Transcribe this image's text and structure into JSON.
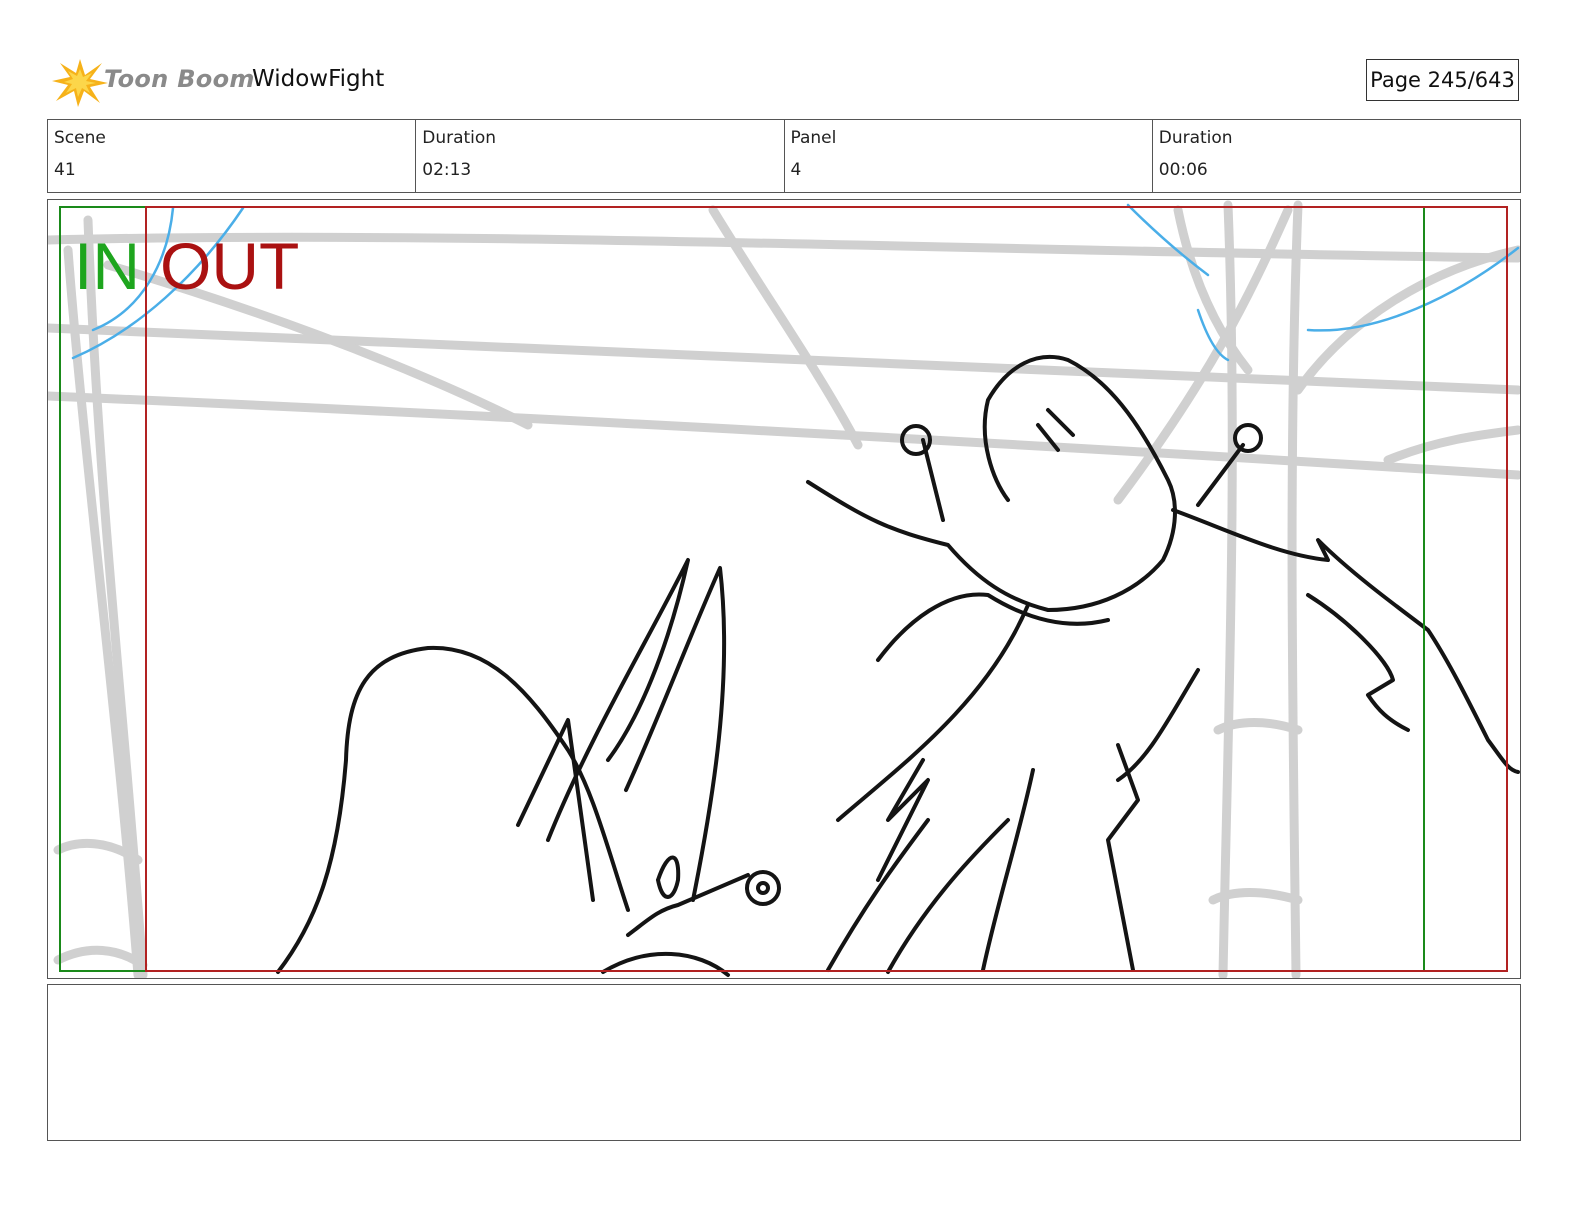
{
  "header": {
    "logo_text": "Toon Boom",
    "project_title": "WidowFight",
    "page_label": "Page 245/643"
  },
  "info": [
    {
      "label": "Scene",
      "value": "41"
    },
    {
      "label": "Duration",
      "value": "02:13"
    },
    {
      "label": "Panel",
      "value": "4"
    },
    {
      "label": "Duration",
      "value": "00:06"
    }
  ],
  "panel": {
    "in_label": "IN",
    "out_label": "OUT",
    "in_color": "#1ea51e",
    "out_color": "#aa1111"
  },
  "caption": {
    "text": ""
  },
  "icons": {
    "logo": "toon-boom-starburst-icon"
  }
}
